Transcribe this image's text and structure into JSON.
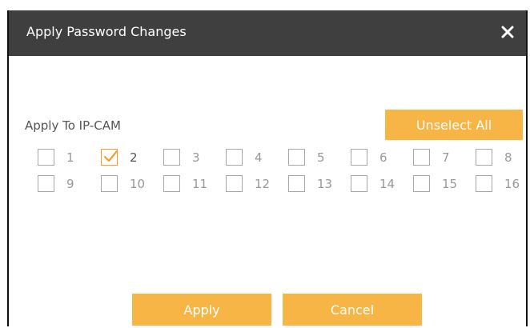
{
  "dialog": {
    "title": "Apply Password Changes",
    "close_icon": "close-icon",
    "label": "Apply To IP-CAM",
    "unselect_all": "Unselect All",
    "apply": "Apply",
    "cancel": "Cancel",
    "accent_color": "#f7b545",
    "titlebar_color": "#3f3f3f"
  },
  "cameras": [
    {
      "label": "1",
      "checked": false
    },
    {
      "label": "2",
      "checked": true
    },
    {
      "label": "3",
      "checked": false
    },
    {
      "label": "4",
      "checked": false
    },
    {
      "label": "5",
      "checked": false
    },
    {
      "label": "6",
      "checked": false
    },
    {
      "label": "7",
      "checked": false
    },
    {
      "label": "8",
      "checked": false
    },
    {
      "label": "9",
      "checked": false
    },
    {
      "label": "10",
      "checked": false
    },
    {
      "label": "11",
      "checked": false
    },
    {
      "label": "12",
      "checked": false
    },
    {
      "label": "13",
      "checked": false
    },
    {
      "label": "14",
      "checked": false
    },
    {
      "label": "15",
      "checked": false
    },
    {
      "label": "16",
      "checked": false
    }
  ]
}
